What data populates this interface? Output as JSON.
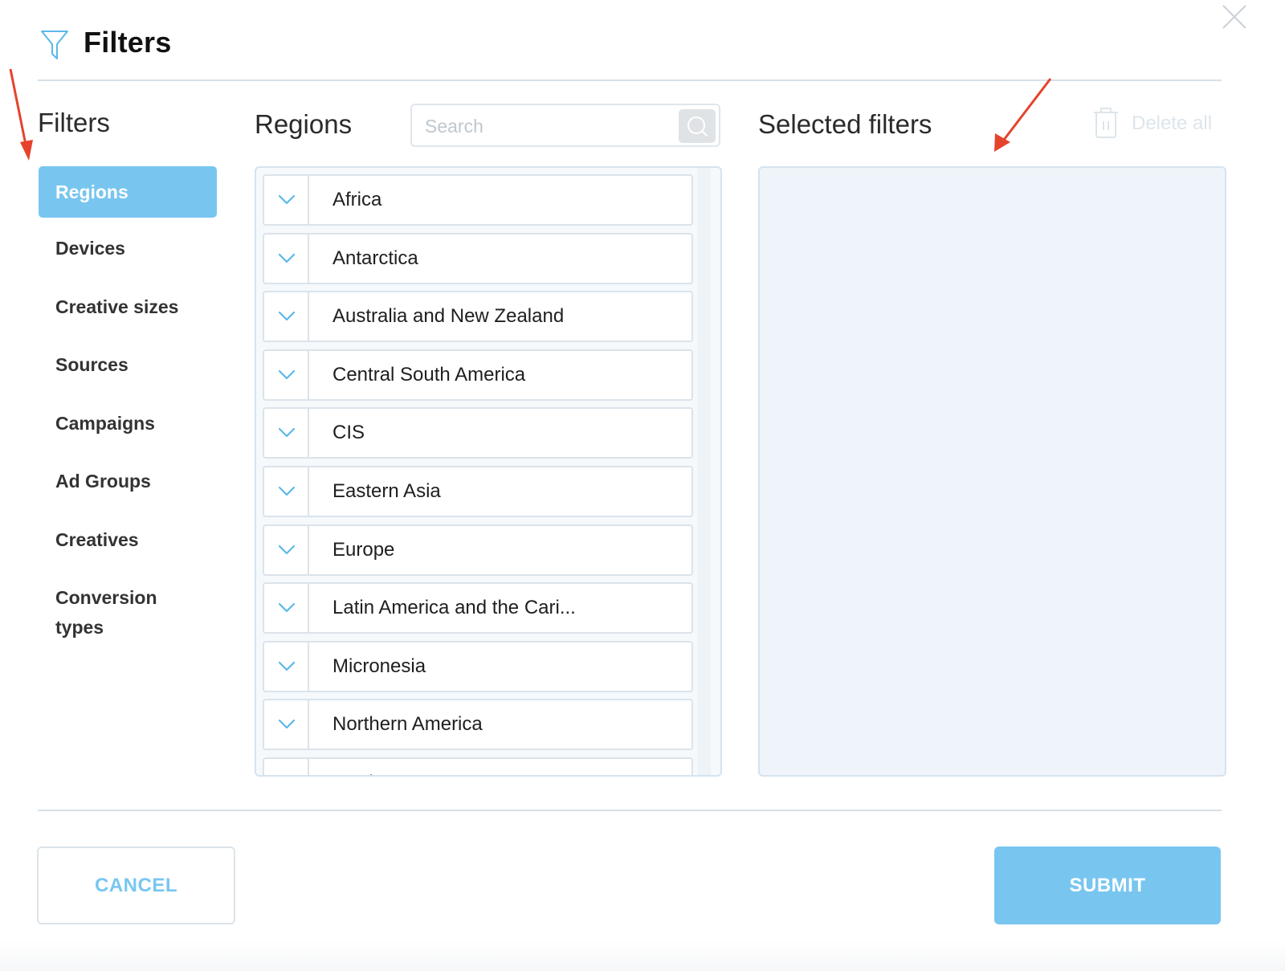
{
  "header": {
    "title": "Filters",
    "icon": "funnel-icon",
    "close_icon": "close-icon"
  },
  "nav": {
    "heading": "Filters",
    "items": [
      {
        "label": "Regions",
        "active": true
      },
      {
        "label": "Devices",
        "active": false
      },
      {
        "label": "Creative sizes",
        "active": false
      },
      {
        "label": "Sources",
        "active": false
      },
      {
        "label": "Campaigns",
        "active": false
      },
      {
        "label": "Ad Groups",
        "active": false
      },
      {
        "label": "Creatives",
        "active": false
      },
      {
        "label": "Conversion types",
        "active": false
      }
    ]
  },
  "regions": {
    "heading": "Regions",
    "search_placeholder": "Search",
    "search_value": "",
    "items": [
      "Africa",
      "Antarctica",
      "Australia and New Zealand",
      "Central South America",
      "CIS",
      "Eastern Asia",
      "Europe",
      "Latin America and the Cari...",
      "Micronesia",
      "Northern America",
      "Northern E..."
    ]
  },
  "selected": {
    "heading": "Selected filters",
    "delete_all_label": "Delete all",
    "delete_icon": "trash-icon"
  },
  "footer": {
    "cancel_label": "CANCEL",
    "submit_label": "SUBMIT"
  },
  "colors": {
    "accent": "#78c6f0",
    "chevron": "#5bb8e8",
    "border": "#dbe3ea",
    "panel_bg": "#eef4f9",
    "annotation_arrow": "#e5432d"
  }
}
